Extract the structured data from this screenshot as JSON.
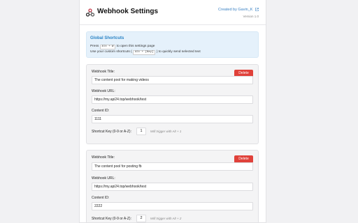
{
  "header": {
    "title": "Webhook Settings",
    "creator": "Created by Gavin_K",
    "version": "Version 1.0"
  },
  "shortcuts": {
    "title": "Global Shortcuts",
    "line1_prefix": "Press",
    "line1_key": "Alt + W",
    "line1_suffix": "to open this settings page",
    "line2_prefix": "Use your custom shortcuts (",
    "line2_key": "Alt + [Key]",
    "line2_suffix": ") to quickly send selected text"
  },
  "labels": {
    "webhook_title": "Webhook Title:",
    "webhook_url": "Webhook URL:",
    "content_id": "Content ID:",
    "shortcut_key": "Shortcut Key (0-9 or A-Z):",
    "delete": "Delete"
  },
  "webhooks": [
    {
      "title": "The content pool for making videos",
      "url": "https://my.api24.top/webhook/test",
      "content_id": "1111",
      "key": "1",
      "hint": "Will trigger with Alt + 1"
    },
    {
      "title": "The content pool for posting fb",
      "url": "https://my.api24.top/webhook/test",
      "content_id": "2222",
      "key": "2",
      "hint": "Will trigger with Alt + 2"
    }
  ],
  "colors": {
    "accent": "#2a83c5",
    "danger": "#e0413a",
    "info_bg": "#e5f1fb"
  }
}
